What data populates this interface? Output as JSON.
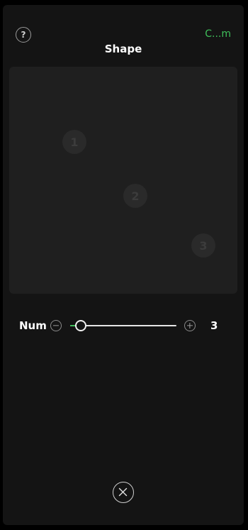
{
  "header": {
    "help_label": "?",
    "confirm_label": "C...m",
    "title": "Shape"
  },
  "canvas": {
    "markers": [
      {
        "label": "1"
      },
      {
        "label": "2"
      },
      {
        "label": "3"
      }
    ]
  },
  "controls": {
    "num_label": "Num",
    "value": "3",
    "slider_fraction": 0.1
  },
  "footer": {
    "close_icon": "close-icon"
  },
  "colors": {
    "accent": "#3fbf5a",
    "panel_bg": "#141414",
    "canvas_bg": "#1f1f1f"
  }
}
